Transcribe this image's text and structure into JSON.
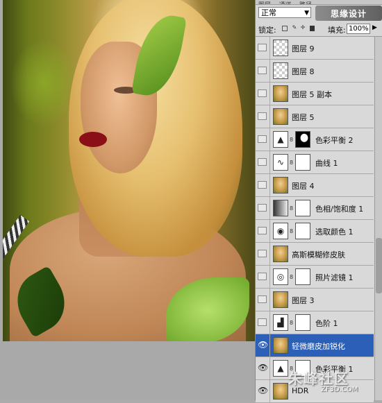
{
  "panel": {
    "tabs": [
      "图层",
      "通道",
      "路径"
    ],
    "blend_mode": "正常",
    "logo_text": "思缘设计",
    "lock_label": "锁定:",
    "fill_label": "填充:",
    "fill_value": "100%"
  },
  "layers": [
    {
      "name": "图层 9",
      "visible": false
    },
    {
      "name": "图层 8",
      "visible": false
    },
    {
      "name": "图层 5 副本",
      "visible": false
    },
    {
      "name": "图层 5",
      "visible": false
    },
    {
      "name": "色彩平衡 2",
      "visible": false
    },
    {
      "name": "曲线 1",
      "visible": false
    },
    {
      "name": "图层 4",
      "visible": false
    },
    {
      "name": "色相/饱和度 1",
      "visible": false
    },
    {
      "name": "选取颜色 1",
      "visible": false
    },
    {
      "name": "高斯模糊修皮肤",
      "visible": false
    },
    {
      "name": "照片滤镜 1",
      "visible": false
    },
    {
      "name": "图层 3",
      "visible": false
    },
    {
      "name": "色阶 1",
      "visible": false
    },
    {
      "name": "轻微磨皮加锐化",
      "visible": true,
      "selected": true
    },
    {
      "name": "色彩平衡 1",
      "visible": true
    },
    {
      "name": "HDR",
      "visible": true
    }
  ],
  "watermark": {
    "main": "朱峰社区",
    "sub": "ZF3D.COM"
  }
}
